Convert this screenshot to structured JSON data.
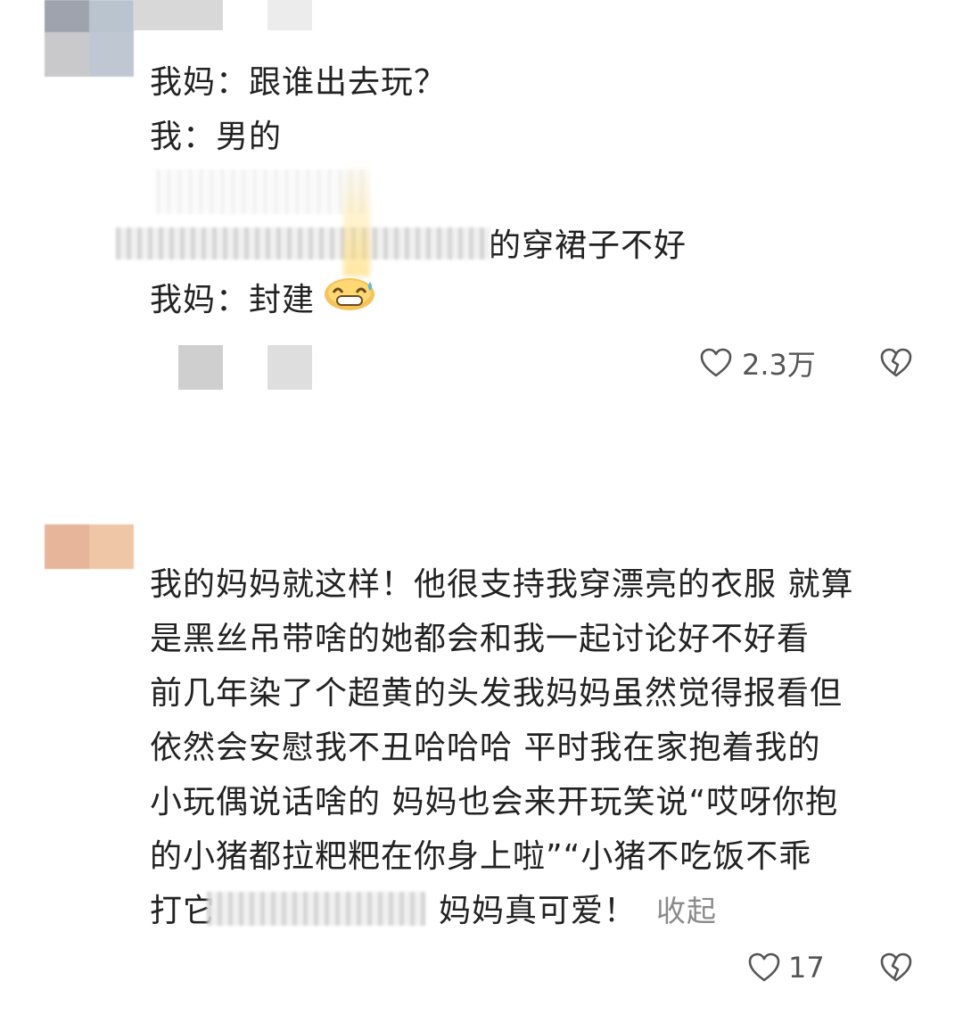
{
  "comments": [
    {
      "lines": [
        "我妈：跟谁出去玩？",
        "我：男的",
        "",
        "的穿裙子不好",
        "我妈：封建"
      ],
      "like_count": "2.3万"
    },
    {
      "lines": [
        "我的妈妈就这样！他很支持我穿漂亮的衣服 就算",
        "是黑丝吊带啥的她都会和我一起讨论好不好看",
        "前几年染了个超黄的头发我妈妈虽然觉得报看但",
        "依然会安慰我不丑哈哈哈 平时我在家抱着我的",
        "小玩偶说话啥的 妈妈也会来开玩笑说“哎呀你抱",
        "的小猪都拉粑粑在你身上啦”“小猪不吃饭不乖",
        "打它",
        "妈妈真可爱！"
      ],
      "collapse_label": "收起",
      "like_count": "17"
    }
  ],
  "icons": {
    "like": "heart-outline-icon",
    "dislike": "broken-heart-icon",
    "emoji": "grinning-sweat-emoji"
  },
  "colors": {
    "text": "#222222",
    "muted": "#8a8a8a",
    "icon": "#555555"
  }
}
